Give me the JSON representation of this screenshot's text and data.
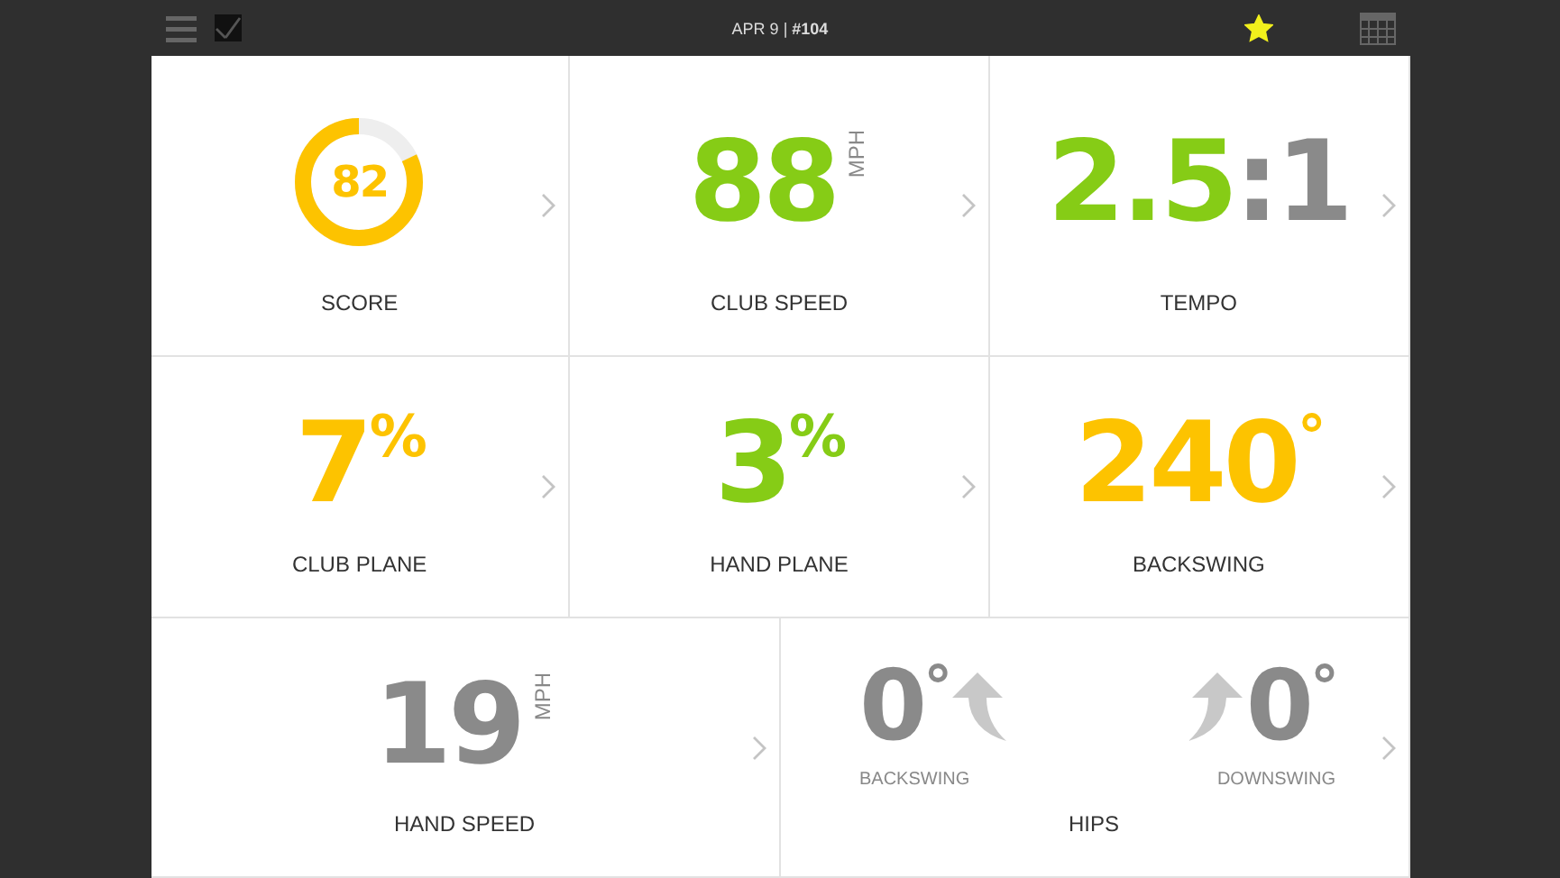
{
  "top_bar": {
    "title": "APR 9 | **#104**",
    "starred": true
  },
  "tiles": [
    {
      "kind": "ring",
      "value": "82",
      "label": "SCORE"
    },
    {
      "kind": "number",
      "parts": [
        {
          "text": "88",
          "color": "#86cc16",
          "kind": "main"
        }
      ],
      "unit": "MPH",
      "label": "CLUB SPEED"
    },
    {
      "kind": "number",
      "parts": [
        {
          "text": "2.5",
          "color": "#86cc16",
          "kind": "main"
        },
        {
          "text": ":1",
          "color": "#8a8a8a",
          "kind": "main"
        }
      ],
      "label": "TEMPO"
    },
    {
      "kind": "number",
      "parts": [
        {
          "text": "7",
          "color": "#fdc300",
          "kind": "main"
        },
        {
          "text": "%",
          "color": "#fdc300",
          "kind": "raised"
        }
      ],
      "label": "CLUB PLANE"
    },
    {
      "kind": "number",
      "parts": [
        {
          "text": "3",
          "color": "#86cc16",
          "kind": "main"
        },
        {
          "text": "%",
          "color": "#86cc16",
          "kind": "raised"
        }
      ],
      "label": "HAND PLANE"
    },
    {
      "kind": "number",
      "parts": [
        {
          "text": "240",
          "color": "#fdc300",
          "kind": "main"
        },
        {
          "text": "°",
          "color": "#fdc300",
          "kind": "raised"
        }
      ],
      "label": "BACKSWING"
    },
    {
      "kind": "number",
      "parts": [
        {
          "text": "19",
          "color": "#8a8a8a",
          "kind": "main"
        }
      ],
      "unit": "MPH",
      "label": "HAND SPEED"
    },
    {
      "kind": "pair",
      "sides": [
        {
          "value": "0",
          "mark": "°",
          "kind": "left",
          "caption": "BACKSWING"
        },
        {
          "value": "0",
          "mark": "°",
          "kind": "right",
          "caption": "DOWNSWING"
        }
      ],
      "label": "HIPS"
    }
  ]
}
